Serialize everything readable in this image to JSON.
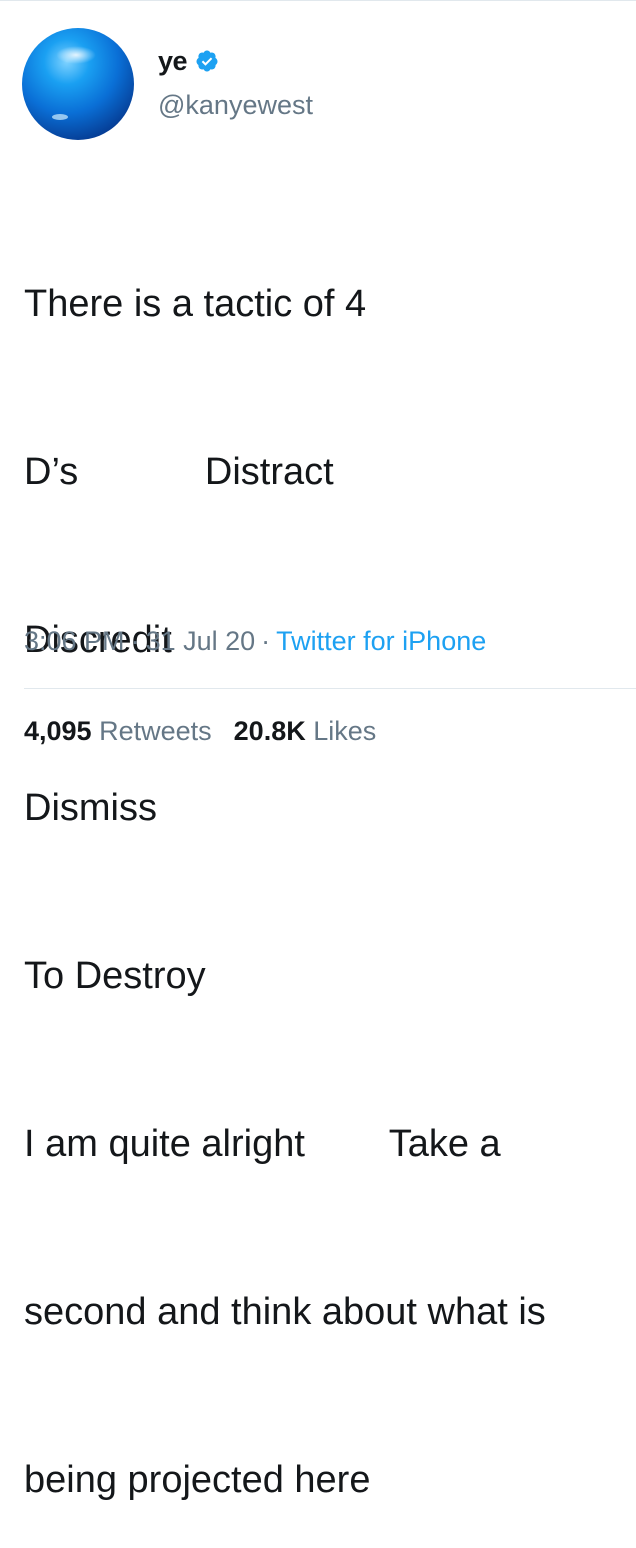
{
  "author": {
    "display_name": "ye",
    "handle": "@kanyewest",
    "verified_icon": "verified-badge-icon",
    "avatar_icon": "blue-sphere-avatar"
  },
  "tweet": {
    "lines": [
      "There is a tactic of 4",
      "D’s            Distract",
      "Discredit",
      "Dismiss",
      "To Destroy",
      "I am quite alright        Take a",
      "second and think about what is",
      "being projected here"
    ]
  },
  "meta": {
    "time": "3:06 PM",
    "separator": "·",
    "date": "31 Jul 20",
    "source": "Twitter for iPhone"
  },
  "stats": {
    "retweets_count": "4,095",
    "retweets_label": "Retweets",
    "likes_count": "20.8K",
    "likes_label": "Likes"
  },
  "colors": {
    "text": "#14171a",
    "secondary": "#657786",
    "link": "#1da1f2",
    "divider": "#e1e8ed"
  }
}
